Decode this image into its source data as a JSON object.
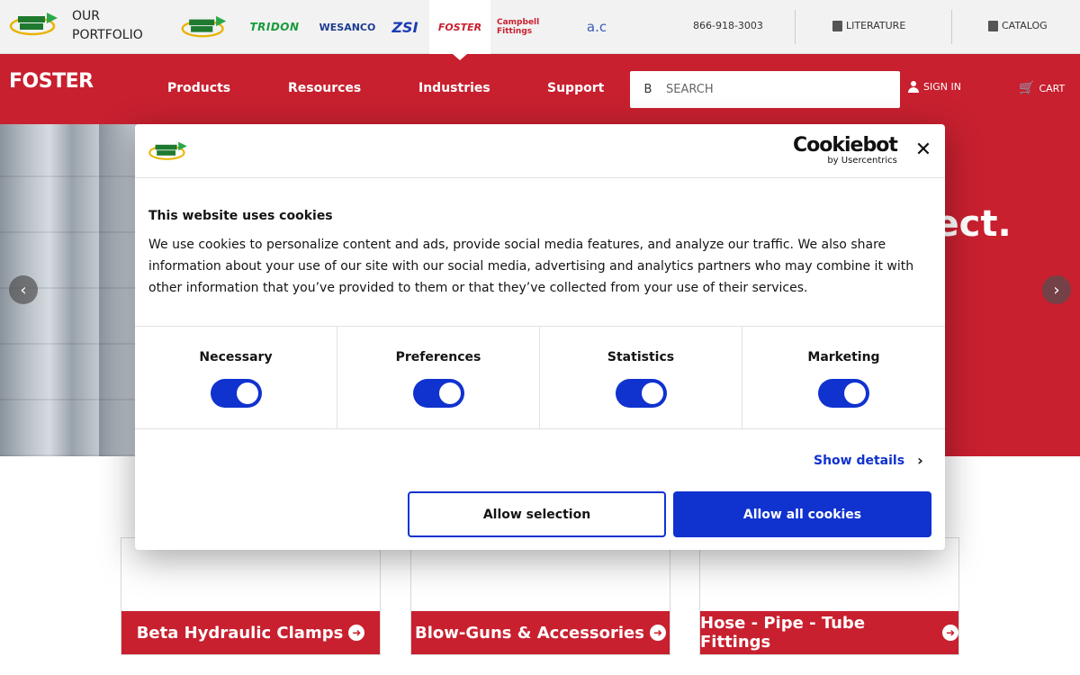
{
  "topbar": {
    "portfolio_label": "OUR\nPORTFOLIO",
    "brands": {
      "tridon": "TRIDON",
      "wesanco": "WESANCO",
      "zsi": "ZSI",
      "foster": "FOSTER",
      "campbell": "Campbell Fittings",
      "acl": "a.c"
    },
    "phone": "866-918-3003",
    "literature": "LITERATURE",
    "catalog": "CATALOG"
  },
  "header": {
    "logo": "FOSTER",
    "nav": [
      "Products",
      "Resources",
      "Industries",
      "Support"
    ],
    "search": {
      "icon_glyph": "B",
      "placeholder": "SEARCH"
    },
    "sign_in": "SIGN IN",
    "cart": "CART"
  },
  "hero": {
    "headline": "nect."
  },
  "cards": [
    {
      "label": "Beta Hydraulic Clamps"
    },
    {
      "label": "Blow-Guns & Accessories"
    },
    {
      "label": "Hose - Pipe - Tube Fittings"
    }
  ],
  "cookie_dialog": {
    "brand_name": "Cookiebot",
    "brand_by": "by Usercentrics",
    "title": "This website uses cookies",
    "body": "We use cookies to personalize content and ads, provide social media features, and analyze our traffic. We also share information about your use of our site with our social media, advertising and analytics partners who may combine it with other information that you’ve provided to them or that they’ve collected from your use of their services.",
    "categories": [
      {
        "label": "Necessary",
        "enabled": true
      },
      {
        "label": "Preferences",
        "enabled": true
      },
      {
        "label": "Statistics",
        "enabled": true
      },
      {
        "label": "Marketing",
        "enabled": true
      }
    ],
    "show_details": "Show details",
    "allow_selection": "Allow selection",
    "allow_all": "Allow all cookies"
  },
  "colors": {
    "brand_red": "#c8202f",
    "cookiebot_blue": "#1032cf"
  }
}
